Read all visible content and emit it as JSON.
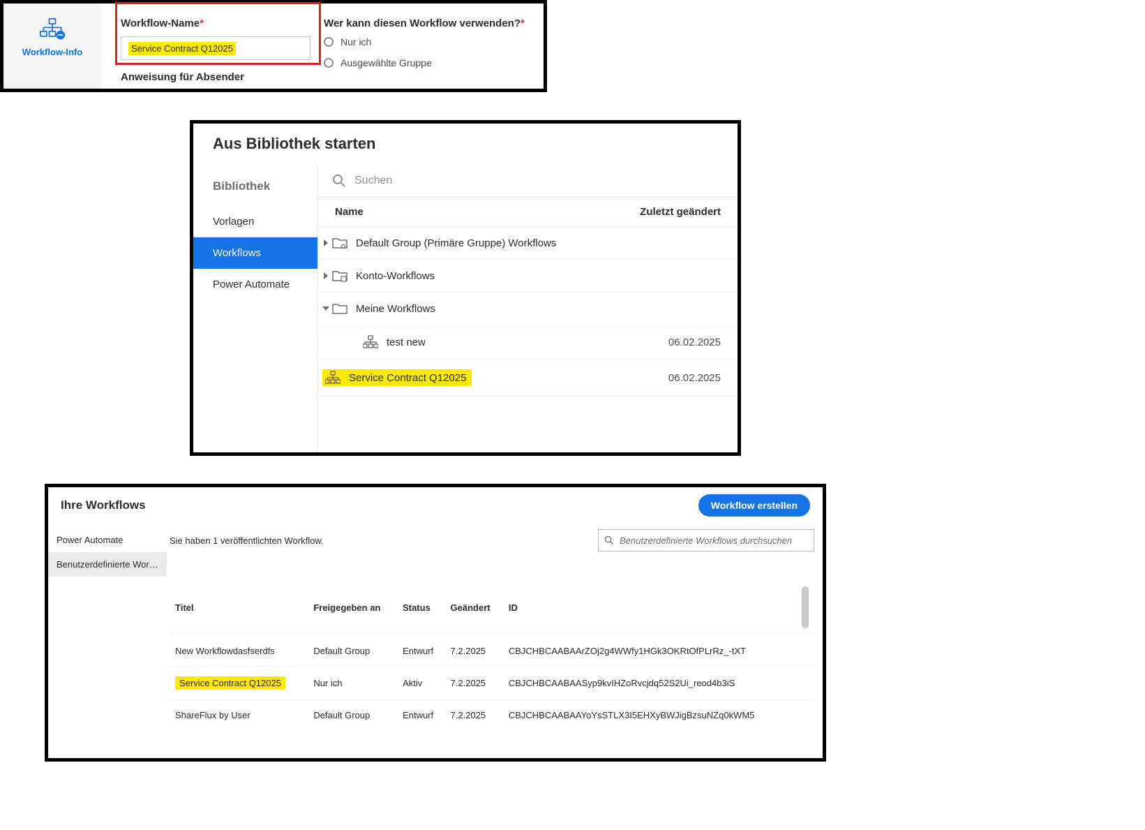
{
  "panel1": {
    "side_label": "Workflow-Info",
    "name_label": "Workflow-Name",
    "name_value": "Service Contract Q12025",
    "instr_label": "Anweisung für Absender",
    "who_label": "Wer kann diesen Workflow verwenden?",
    "opt_me": "Nur ich",
    "opt_group": "Ausgewählte Gruppe"
  },
  "panel2": {
    "title": "Aus Bibliothek starten",
    "side_title": "Bibliothek",
    "side_items": [
      "Vorlagen",
      "Workflows",
      "Power Automate"
    ],
    "search_placeholder": "Suchen",
    "col_name": "Name",
    "col_changed": "Zuletzt geändert",
    "rows": {
      "group1": "Default Group (Primäre Gruppe) Workflows",
      "group2": "Konto-Workflows",
      "group3": "Meine Workflows",
      "item1": {
        "name": "test new",
        "date": "06.02.2025"
      },
      "item2": {
        "name": "Service Contract Q12025",
        "date": "06.02.2025"
      }
    }
  },
  "panel3": {
    "title": "Ihre Workflows",
    "create_btn": "Workflow erstellen",
    "side_items": [
      "Power Automate",
      "Benutzerdefinierte Workfl..."
    ],
    "status_msg": "Sie haben 1 veröffentlichten Workflow.",
    "search_placeholder": "Benutzerdefinierte Workflows durchsuchen",
    "headers": {
      "title": "Titel",
      "shared": "Freigegeben an",
      "status": "Status",
      "changed": "Geändert",
      "id": "ID"
    },
    "rows": [
      {
        "title": "New Workflowdasfserdfs",
        "shared": "Default Group",
        "status": "Entwurf",
        "changed": "7.2.2025",
        "id": "CBJCHBCAABAArZOj2g4WWfy1HGk3OKRtOfPLrRz_-tXT",
        "hl": false
      },
      {
        "title": "Service Contract Q12025",
        "shared": "Nur ich",
        "status": "Aktiv",
        "changed": "7.2.2025",
        "id": "CBJCHBCAABAASyp9kvIHZoRvcjdq52S2Ui_reod4b3iS",
        "hl": true
      },
      {
        "title": "ShareFlux by User",
        "shared": "Default Group",
        "status": "Entwurf",
        "changed": "7.2.2025",
        "id": "CBJCHBCAABAAYoYsSTLX3I5EHXyBWJigBzsuNZq0kWM5",
        "hl": false
      }
    ]
  }
}
